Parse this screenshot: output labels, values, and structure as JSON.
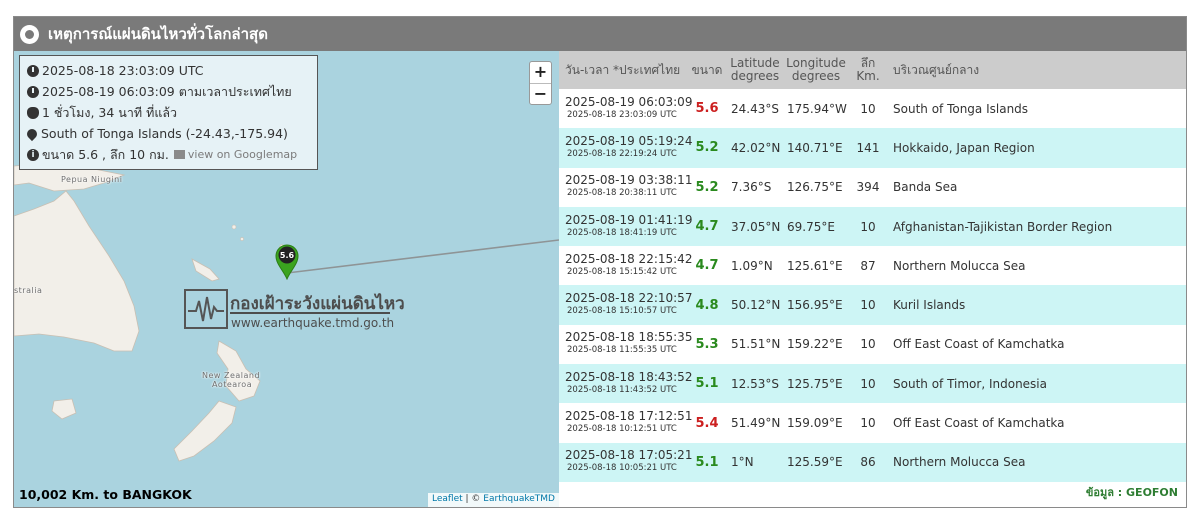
{
  "title": "เหตุการณ์แผ่นดินไหวทั่วโลกล่าสุด",
  "colors": {
    "mag_red": "#cc1f1f",
    "mag_green": "#2a8a1e",
    "row_alt": "#cdf5f5",
    "header_bg": "#cccccc",
    "title_bg": "#7a7a7a"
  },
  "info": {
    "utc_time": "2025-08-18 23:03:09 UTC",
    "thai_time": "2025-08-19 06:03:09 ตามเวลาประเทศไทย",
    "elapsed": "1 ชั่วโมง, 34 นาที ที่แล้ว",
    "location": "South of Tonga Islands (-24.43,-175.94)",
    "magnitude_depth": "ขนาด 5.6 , ลึก 10 กม.",
    "gmap_link": "view on Googlemap"
  },
  "map": {
    "zoom_in": "+",
    "zoom_out": "−",
    "labels": {
      "png": "Pepua Niugini",
      "aus": "stralia",
      "nz_1": "New Zealand",
      "nz_2": "Aotearoa"
    },
    "marker_label": "5.6",
    "watermark_thai": "กองเฝ้าระวังแผ่นดินไหว",
    "watermark_url": "www.earthquake.tmd.go.th",
    "distance": "10,002 Km. to BANGKOK",
    "attribution_leaflet": "Leaflet",
    "attribution_sep": " | © ",
    "attribution_tmd": "EarthquakeTMD"
  },
  "table": {
    "headers": {
      "datetime": "วัน-เวลา *ประเทศไทย",
      "magnitude": "ขนาด",
      "lat_1": "Latitude",
      "lat_2": "degrees",
      "lon_1": "Longitude",
      "lon_2": "degrees",
      "depth_1": "ลึก",
      "depth_2": "Km.",
      "region": "บริเวณศูนย์กลาง"
    },
    "rows": [
      {
        "local": "2025-08-19 06:03:09",
        "utc": "2025-08-18 23:03:09 UTC",
        "mag": "5.6",
        "mag_color": "#cc1f1f",
        "lat": "24.43°S",
        "lon": "175.94°W",
        "depth": "10",
        "region": "South of Tonga Islands"
      },
      {
        "local": "2025-08-19 05:19:24",
        "utc": "2025-08-18 22:19:24 UTC",
        "mag": "5.2",
        "mag_color": "#2a8a1e",
        "lat": "42.02°N",
        "lon": "140.71°E",
        "depth": "141",
        "region": "Hokkaido, Japan Region"
      },
      {
        "local": "2025-08-19 03:38:11",
        "utc": "2025-08-18 20:38:11 UTC",
        "mag": "5.2",
        "mag_color": "#2a8a1e",
        "lat": "7.36°S",
        "lon": "126.75°E",
        "depth": "394",
        "region": "Banda Sea"
      },
      {
        "local": "2025-08-19 01:41:19",
        "utc": "2025-08-18 18:41:19 UTC",
        "mag": "4.7",
        "mag_color": "#2a8a1e",
        "lat": "37.05°N",
        "lon": "69.75°E",
        "depth": "10",
        "region": "Afghanistan-Tajikistan Border Region"
      },
      {
        "local": "2025-08-18 22:15:42",
        "utc": "2025-08-18 15:15:42 UTC",
        "mag": "4.7",
        "mag_color": "#2a8a1e",
        "lat": "1.09°N",
        "lon": "125.61°E",
        "depth": "87",
        "region": "Northern Molucca Sea"
      },
      {
        "local": "2025-08-18 22:10:57",
        "utc": "2025-08-18 15:10:57 UTC",
        "mag": "4.8",
        "mag_color": "#2a8a1e",
        "lat": "50.12°N",
        "lon": "156.95°E",
        "depth": "10",
        "region": "Kuril Islands"
      },
      {
        "local": "2025-08-18 18:55:35",
        "utc": "2025-08-18 11:55:35 UTC",
        "mag": "5.3",
        "mag_color": "#2a8a1e",
        "lat": "51.51°N",
        "lon": "159.22°E",
        "depth": "10",
        "region": "Off East Coast of Kamchatka"
      },
      {
        "local": "2025-08-18 18:43:52",
        "utc": "2025-08-18 11:43:52 UTC",
        "mag": "5.1",
        "mag_color": "#2a8a1e",
        "lat": "12.53°S",
        "lon": "125.75°E",
        "depth": "10",
        "region": "South of Timor, Indonesia"
      },
      {
        "local": "2025-08-18 17:12:51",
        "utc": "2025-08-18 10:12:51 UTC",
        "mag": "5.4",
        "mag_color": "#cc1f1f",
        "lat": "51.49°N",
        "lon": "159.09°E",
        "depth": "10",
        "region": "Off East Coast of Kamchatka"
      },
      {
        "local": "2025-08-18 17:05:21",
        "utc": "2025-08-18 10:05:21 UTC",
        "mag": "5.1",
        "mag_color": "#2a8a1e",
        "lat": "1°N",
        "lon": "125.59°E",
        "depth": "86",
        "region": "Northern Molucca Sea"
      }
    ]
  },
  "source": "ข้อมูล : GEOFON"
}
